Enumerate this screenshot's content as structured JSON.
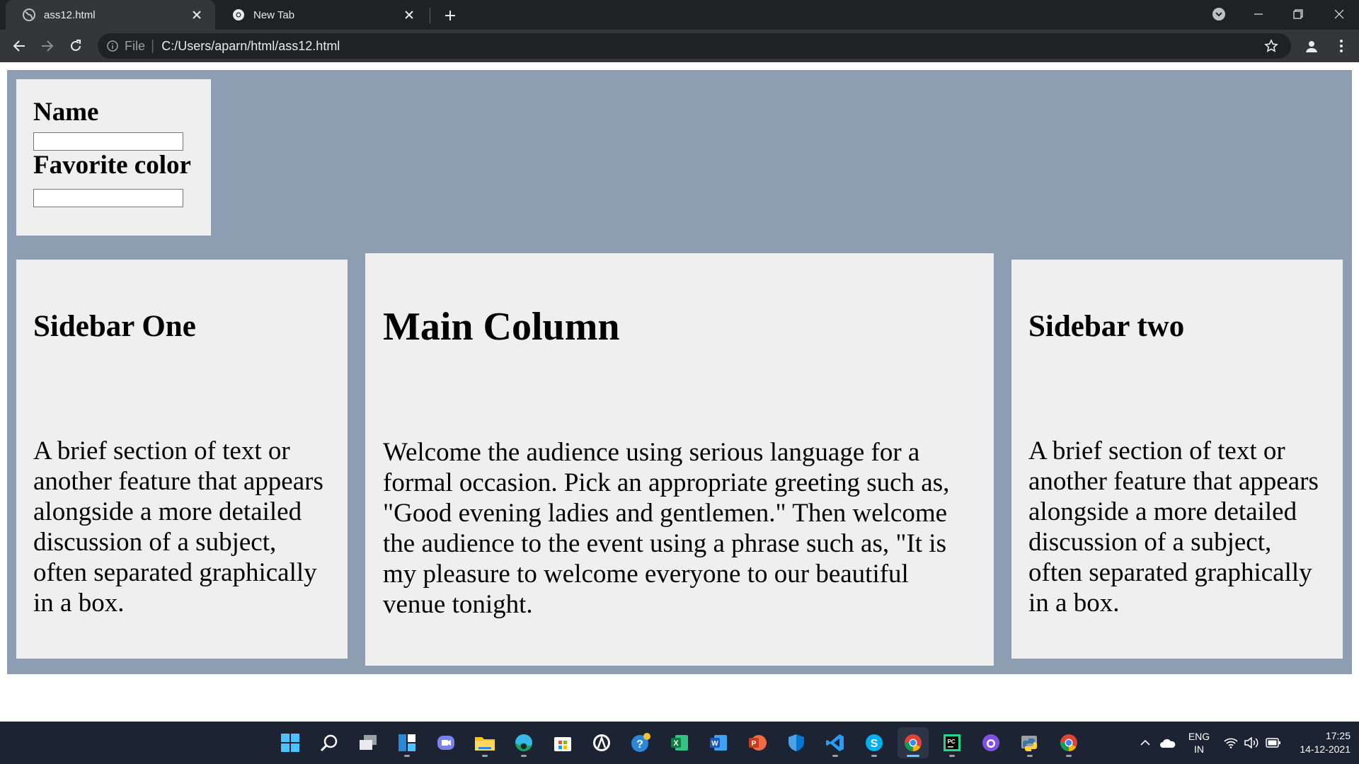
{
  "browser": {
    "tabs": [
      {
        "title": "ass12.html",
        "active": true
      },
      {
        "title": "New Tab",
        "active": false
      }
    ],
    "address": {
      "scheme_label": "File",
      "url": "C:/Users/aparn/html/ass12.html"
    }
  },
  "form": {
    "name_label": "Name",
    "name_value": "",
    "color_label": "Favorite color",
    "color_value": ""
  },
  "sidebar_one": {
    "heading": "Sidebar One",
    "text": "A brief section of text or another feature that appears alongside a more detailed discussion of a subject, often separated graphically in a box."
  },
  "main_column": {
    "heading": "Main Column",
    "text": "Welcome the audience using serious language for a formal occasion. Pick an appropriate greeting such as, \"Good evening ladies and gentlemen.\" Then welcome the audience to the event using a phrase such as, \"It is my pleasure to welcome everyone to our beautiful venue tonight."
  },
  "sidebar_two": {
    "heading": "Sidebar two",
    "text": "A brief section of text or another feature that appears alongside a more detailed discussion of a subject, often separated graphically in a box."
  },
  "taskbar": {
    "apps": [
      "start-icon",
      "search-icon",
      "task-view-icon",
      "widgets-icon",
      "teams-chat-icon",
      "file-explorer-icon",
      "edge-icon",
      "store-icon",
      "app-icon",
      "help-icon",
      "excel-icon",
      "word-icon",
      "powerpoint-icon",
      "defender-icon",
      "vscode-icon",
      "skype-icon",
      "chrome-icon",
      "pycharm-icon",
      "github-desktop-icon",
      "python-icon",
      "chrome-alt-icon"
    ],
    "language_line1": "ENG",
    "language_line2": "IN",
    "time": "17:25",
    "date": "14-12-2021"
  }
}
